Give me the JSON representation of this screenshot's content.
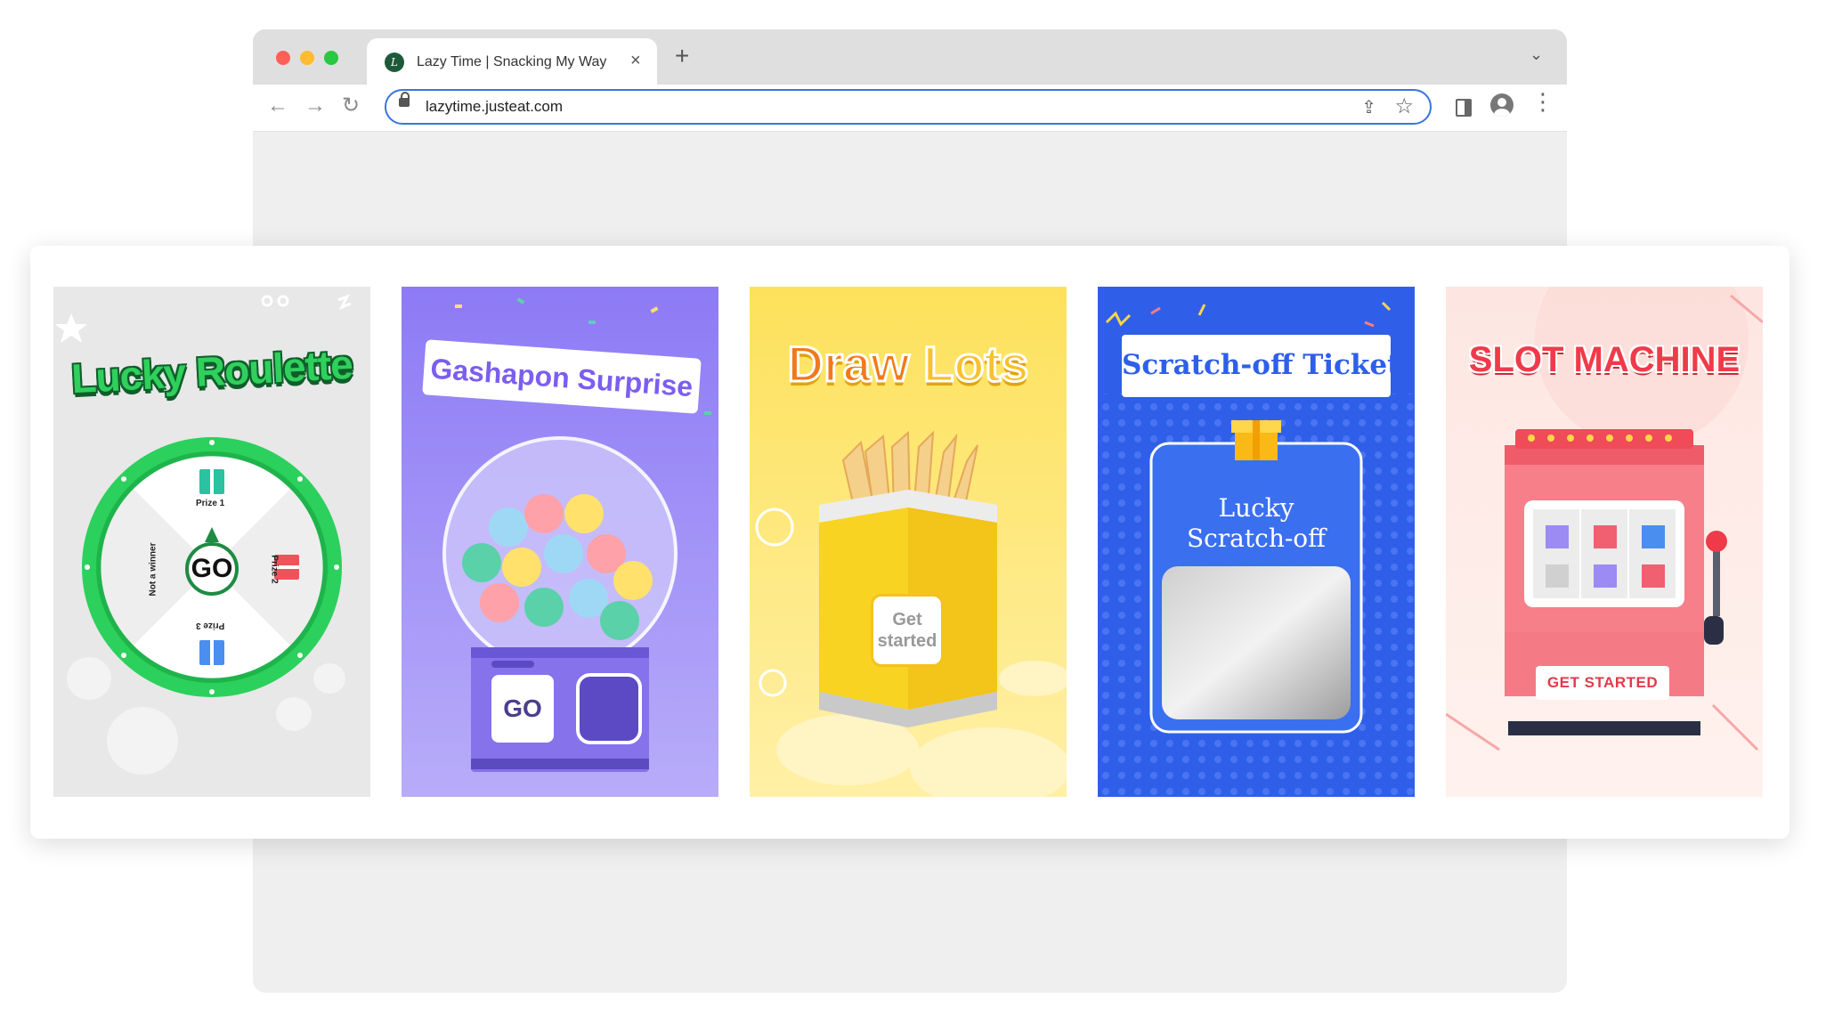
{
  "browser": {
    "tab_title": "Lazy Time | Snacking My Way",
    "tab_favicon_letter": "L",
    "new_tab_label": "+",
    "close_tab_label": "×",
    "url": "lazytime.justeat.com"
  },
  "games": [
    {
      "title": "Lucky Roulette",
      "center_button": "GO",
      "segments": [
        "Prize 1",
        "Prize 2",
        "Prize 3",
        "Not a winner"
      ]
    },
    {
      "title": "Gashapon Surprise",
      "button": "GO"
    },
    {
      "title_part1": "Draw",
      "title_part2": "Lots",
      "button": "Get started"
    },
    {
      "title": "Scratch-off Tickets",
      "label_line1": "Lucky",
      "label_line2": "Scratch-off"
    },
    {
      "title": "SLOT MACHINE",
      "button": "GET STARTED"
    }
  ],
  "colors": {
    "roulette_green": "#2fd05c",
    "gashapon_purple": "#8d7af5",
    "draw_yellow": "#fde15b",
    "scratch_blue": "#2f5fe9",
    "slot_red": "#ef3b49"
  }
}
